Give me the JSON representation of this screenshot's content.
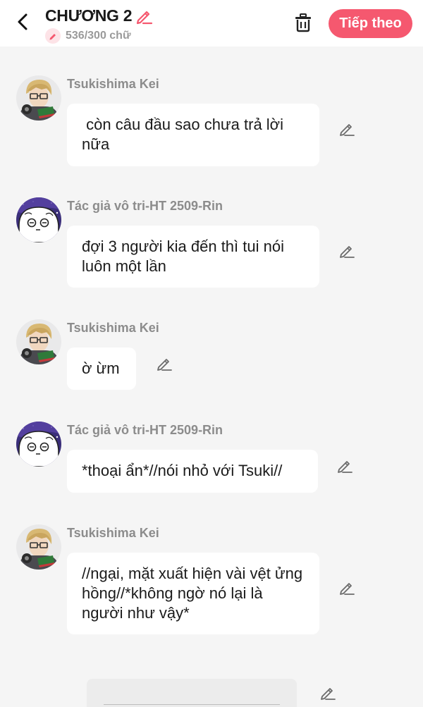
{
  "header": {
    "chapter_title": "CHƯƠNG 2",
    "word_count": "536/300 chữ",
    "next_label": "Tiếp theo",
    "accent_color": "#f5586f"
  },
  "messages": [
    {
      "speaker": "Tsukishima Kei",
      "avatar": "tsukishima-avatar",
      "text": " còn câu đầu sao chưa trả lời nữa"
    },
    {
      "speaker": "Tác giả vô tri-HT 2509-Rin",
      "avatar": "rin-avatar",
      "text": "đợi 3 người kia đến thì tui nói luôn một lần"
    },
    {
      "speaker": "Tsukishima Kei",
      "avatar": "tsukishima-avatar",
      "text": "ờ ừm"
    },
    {
      "speaker": "Tác giả vô tri-HT 2509-Rin",
      "avatar": "rin-avatar",
      "text": "*thoại ẩn*//nói nhỏ với Tsuki//"
    },
    {
      "speaker": "Tsukishima Kei",
      "avatar": "tsukishima-avatar",
      "text": "//ngại, mặt xuất hiện vài vệt ửng hồng//*không ngờ nó lại là người như vậy*"
    }
  ]
}
